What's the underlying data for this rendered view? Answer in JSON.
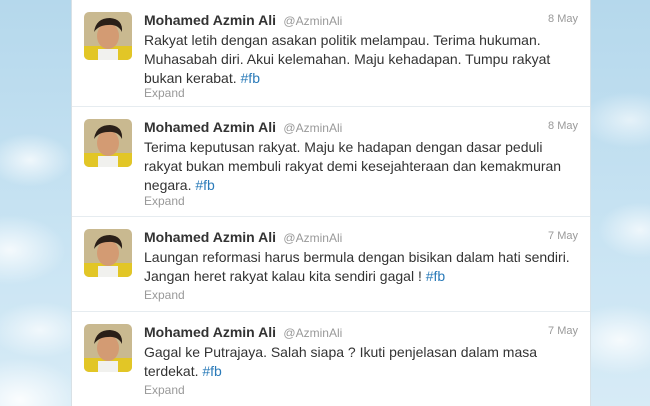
{
  "colors": {
    "link": "#2b7bb9",
    "text": "#333333",
    "muted": "#999999",
    "sky": "#c0deed"
  },
  "tweets": [
    {
      "name": "Mohamed Azmin Ali",
      "handle": "@AzminAli",
      "date": "8 May",
      "text": "Rakyat letih dengan asakan politik melampau. Terima hukuman. Muhasabah diri. Akui kelemahan. Maju kehadapan. Tumpu rakyat bukan kerabat.",
      "hashtag": "#fb",
      "expand": "Expand"
    },
    {
      "name": "Mohamed Azmin Ali",
      "handle": "@AzminAli",
      "date": "8 May",
      "text": "Terima keputusan rakyat. Maju ke hadapan dengan dasar peduli rakyat bukan membuli rakyat demi kesejahteraan dan kemakmuran negara.",
      "hashtag": "#fb",
      "expand": "Expand"
    },
    {
      "name": "Mohamed Azmin Ali",
      "handle": "@AzminAli",
      "date": "7 May",
      "text": "Laungan reformasi harus bermula dengan bisikan dalam hati sendiri. Jangan heret rakyat kalau kita sendiri gagal !",
      "hashtag": "#fb",
      "expand": "Expand"
    },
    {
      "name": "Mohamed Azmin Ali",
      "handle": "@AzminAli",
      "date": "7 May",
      "text": "Gagal ke Putrajaya. Salah siapa ? Ikuti penjelasan dalam masa terdekat.",
      "hashtag": "#fb",
      "expand": "Expand"
    }
  ]
}
